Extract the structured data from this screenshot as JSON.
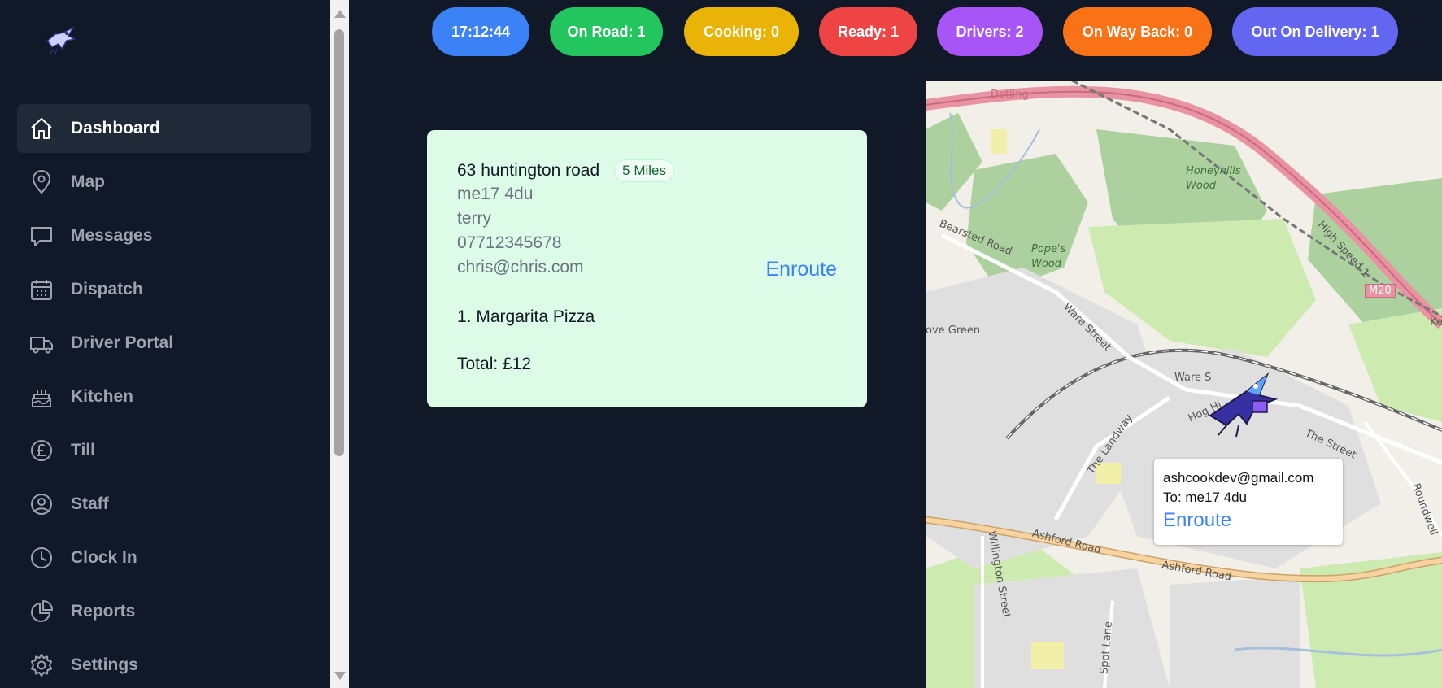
{
  "sidebar": {
    "logo": "roadrunner-logo",
    "items": [
      {
        "label": "Dashboard",
        "icon": "home-icon",
        "active": true
      },
      {
        "label": "Map",
        "icon": "map-pin-icon"
      },
      {
        "label": "Messages",
        "icon": "chat-bubble-icon"
      },
      {
        "label": "Dispatch",
        "icon": "calendar-icon"
      },
      {
        "label": "Driver Portal",
        "icon": "truck-icon"
      },
      {
        "label": "Kitchen",
        "icon": "cake-icon"
      },
      {
        "label": "Till",
        "icon": "pound-icon"
      },
      {
        "label": "Staff",
        "icon": "user-circle-icon"
      },
      {
        "label": "Clock In",
        "icon": "clock-icon"
      },
      {
        "label": "Reports",
        "icon": "pie-chart-icon"
      },
      {
        "label": "Settings",
        "icon": "gear-icon"
      }
    ]
  },
  "status_bar": {
    "pills": [
      {
        "label": "17:12:44",
        "color": "#3b82f6"
      },
      {
        "label": "On Road: 1",
        "color": "#22c55e"
      },
      {
        "label": "Cooking: 0",
        "color": "#eab308"
      },
      {
        "label": "Ready: 1",
        "color": "#ef4444"
      },
      {
        "label": "Drivers: 2",
        "color": "#a855f7"
      },
      {
        "label": "On Way Back: 0",
        "color": "#f97316"
      },
      {
        "label": "Out On Delivery: 1",
        "color": "#6366f1"
      }
    ]
  },
  "order": {
    "address": "63 huntington road",
    "distance": "5 Miles",
    "postcode": "me17 4du",
    "name": "terry",
    "phone": "07712345678",
    "email": "chris@chris.com",
    "status": "Enroute",
    "item": "1. Margarita Pizza",
    "total": "Total: £12"
  },
  "map": {
    "popup": {
      "email": "ashcookdev@gmail.com",
      "to": "To: me17 4du",
      "status": "Enroute"
    },
    "labels": {
      "detling": "Detling",
      "honeyhills": "Honeyhills",
      "wood": "Wood",
      "bearsted_road": "Bearsted Road",
      "popes": "Pope's",
      "popes_wood": "Wood",
      "ware_street": "Ware Street",
      "ware_street_2": "Ware S",
      "hog_hill": "Hog Hi",
      "grove_green": "ove Green",
      "the_landway": "The Landway",
      "the_street": "The Street",
      "ashford_road": "Ashford Road",
      "ashford_road_2": "Ashford Road",
      "willington_street": "Willington Street",
      "spot_lane": "Spot Lane",
      "m20": "M20",
      "high_speed": "High Speed 1",
      "roundwell": "Roundwell",
      "ke": "Ke"
    }
  }
}
